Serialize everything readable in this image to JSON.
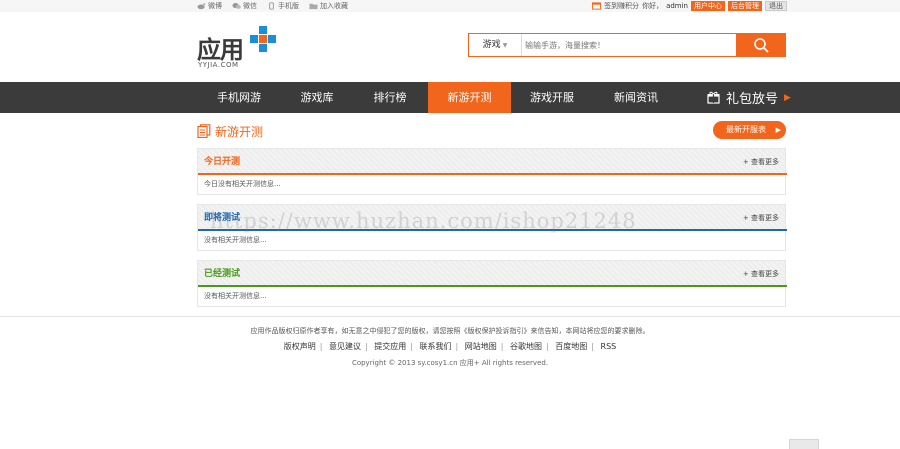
{
  "topbar": {
    "links": [
      {
        "label": "微博",
        "icon": "weibo-icon"
      },
      {
        "label": "微信",
        "icon": "wechat-icon"
      },
      {
        "label": "手机版",
        "icon": "mobile-icon"
      },
      {
        "label": "加入收藏",
        "icon": "folder-icon"
      }
    ],
    "sign_label": "签到赚积分",
    "greeting": "你好，",
    "username": "admin",
    "user_center": "用户中心",
    "admin_panel": "后台管理",
    "logout": "退出"
  },
  "logo": {
    "text": "应用",
    "sub": "YYJIA.COM",
    "icon": "plus-logo-icon",
    "colors": [
      "#1a8fd6",
      "#f1661c"
    ]
  },
  "search": {
    "category": "游戏",
    "placeholder": "输输手游，海量搜索！",
    "icon": "search-icon"
  },
  "nav": {
    "items": [
      "手机网游",
      "游戏库",
      "排行榜",
      "新游开测",
      "游戏开服",
      "新闻资讯"
    ],
    "active_index": 3,
    "gift_label": "礼包放号",
    "gift_icon": "gift-icon"
  },
  "section": {
    "title": "新游开测",
    "icon": "document-icon",
    "button": "最新开服表"
  },
  "panels": [
    {
      "title": "今日开测",
      "more": "+ 查看更多",
      "empty": "今日没有相关开测信息...",
      "color": "#f1661c"
    },
    {
      "title": "即将测试",
      "more": "+ 查看更多",
      "empty": "没有相关开测信息...",
      "color": "#2067b0"
    },
    {
      "title": "已经测试",
      "more": "+ 查看更多",
      "empty": "没有相关开测信息...",
      "color": "#4a9a1a"
    }
  ],
  "footer": {
    "notice": "应用作品版权归原作者享有，如无意之中侵犯了您的版权，请您按照《版权保护投诉指引》来信告知，本网站将应您的要求删除。",
    "links": [
      "版权声明",
      "意见建议",
      "提交应用",
      "联系我们",
      "网站地图",
      "谷歌地图",
      "百度地图",
      "RSS"
    ],
    "copyright": "Copyright © 2013  sy.cosy1.cn  应用+  All rights reserved."
  },
  "watermark": "https://www.huzhan.com/ishop21248",
  "colors": {
    "accent": "#f1661c",
    "nav_bg": "#3b3b3b"
  }
}
